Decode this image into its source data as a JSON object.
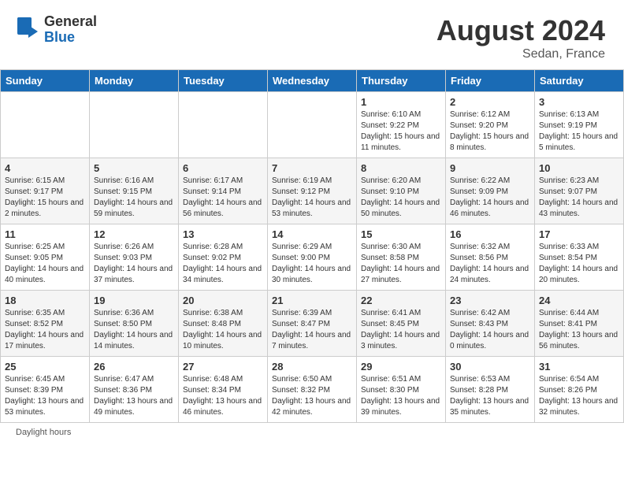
{
  "header": {
    "logo_general": "General",
    "logo_blue": "Blue",
    "month_year": "August 2024",
    "location": "Sedan, France"
  },
  "days_of_week": [
    "Sunday",
    "Monday",
    "Tuesday",
    "Wednesday",
    "Thursday",
    "Friday",
    "Saturday"
  ],
  "footer": {
    "note": "Daylight hours"
  },
  "weeks": [
    {
      "days": [
        {
          "num": "",
          "detail": ""
        },
        {
          "num": "",
          "detail": ""
        },
        {
          "num": "",
          "detail": ""
        },
        {
          "num": "",
          "detail": ""
        },
        {
          "num": "1",
          "detail": "Sunrise: 6:10 AM\nSunset: 9:22 PM\nDaylight: 15 hours\nand 11 minutes."
        },
        {
          "num": "2",
          "detail": "Sunrise: 6:12 AM\nSunset: 9:20 PM\nDaylight: 15 hours\nand 8 minutes."
        },
        {
          "num": "3",
          "detail": "Sunrise: 6:13 AM\nSunset: 9:19 PM\nDaylight: 15 hours\nand 5 minutes."
        }
      ]
    },
    {
      "days": [
        {
          "num": "4",
          "detail": "Sunrise: 6:15 AM\nSunset: 9:17 PM\nDaylight: 15 hours\nand 2 minutes."
        },
        {
          "num": "5",
          "detail": "Sunrise: 6:16 AM\nSunset: 9:15 PM\nDaylight: 14 hours\nand 59 minutes."
        },
        {
          "num": "6",
          "detail": "Sunrise: 6:17 AM\nSunset: 9:14 PM\nDaylight: 14 hours\nand 56 minutes."
        },
        {
          "num": "7",
          "detail": "Sunrise: 6:19 AM\nSunset: 9:12 PM\nDaylight: 14 hours\nand 53 minutes."
        },
        {
          "num": "8",
          "detail": "Sunrise: 6:20 AM\nSunset: 9:10 PM\nDaylight: 14 hours\nand 50 minutes."
        },
        {
          "num": "9",
          "detail": "Sunrise: 6:22 AM\nSunset: 9:09 PM\nDaylight: 14 hours\nand 46 minutes."
        },
        {
          "num": "10",
          "detail": "Sunrise: 6:23 AM\nSunset: 9:07 PM\nDaylight: 14 hours\nand 43 minutes."
        }
      ]
    },
    {
      "days": [
        {
          "num": "11",
          "detail": "Sunrise: 6:25 AM\nSunset: 9:05 PM\nDaylight: 14 hours\nand 40 minutes."
        },
        {
          "num": "12",
          "detail": "Sunrise: 6:26 AM\nSunset: 9:03 PM\nDaylight: 14 hours\nand 37 minutes."
        },
        {
          "num": "13",
          "detail": "Sunrise: 6:28 AM\nSunset: 9:02 PM\nDaylight: 14 hours\nand 34 minutes."
        },
        {
          "num": "14",
          "detail": "Sunrise: 6:29 AM\nSunset: 9:00 PM\nDaylight: 14 hours\nand 30 minutes."
        },
        {
          "num": "15",
          "detail": "Sunrise: 6:30 AM\nSunset: 8:58 PM\nDaylight: 14 hours\nand 27 minutes."
        },
        {
          "num": "16",
          "detail": "Sunrise: 6:32 AM\nSunset: 8:56 PM\nDaylight: 14 hours\nand 24 minutes."
        },
        {
          "num": "17",
          "detail": "Sunrise: 6:33 AM\nSunset: 8:54 PM\nDaylight: 14 hours\nand 20 minutes."
        }
      ]
    },
    {
      "days": [
        {
          "num": "18",
          "detail": "Sunrise: 6:35 AM\nSunset: 8:52 PM\nDaylight: 14 hours\nand 17 minutes."
        },
        {
          "num": "19",
          "detail": "Sunrise: 6:36 AM\nSunset: 8:50 PM\nDaylight: 14 hours\nand 14 minutes."
        },
        {
          "num": "20",
          "detail": "Sunrise: 6:38 AM\nSunset: 8:48 PM\nDaylight: 14 hours\nand 10 minutes."
        },
        {
          "num": "21",
          "detail": "Sunrise: 6:39 AM\nSunset: 8:47 PM\nDaylight: 14 hours\nand 7 minutes."
        },
        {
          "num": "22",
          "detail": "Sunrise: 6:41 AM\nSunset: 8:45 PM\nDaylight: 14 hours\nand 3 minutes."
        },
        {
          "num": "23",
          "detail": "Sunrise: 6:42 AM\nSunset: 8:43 PM\nDaylight: 14 hours\nand 0 minutes."
        },
        {
          "num": "24",
          "detail": "Sunrise: 6:44 AM\nSunset: 8:41 PM\nDaylight: 13 hours\nand 56 minutes."
        }
      ]
    },
    {
      "days": [
        {
          "num": "25",
          "detail": "Sunrise: 6:45 AM\nSunset: 8:39 PM\nDaylight: 13 hours\nand 53 minutes."
        },
        {
          "num": "26",
          "detail": "Sunrise: 6:47 AM\nSunset: 8:36 PM\nDaylight: 13 hours\nand 49 minutes."
        },
        {
          "num": "27",
          "detail": "Sunrise: 6:48 AM\nSunset: 8:34 PM\nDaylight: 13 hours\nand 46 minutes."
        },
        {
          "num": "28",
          "detail": "Sunrise: 6:50 AM\nSunset: 8:32 PM\nDaylight: 13 hours\nand 42 minutes."
        },
        {
          "num": "29",
          "detail": "Sunrise: 6:51 AM\nSunset: 8:30 PM\nDaylight: 13 hours\nand 39 minutes."
        },
        {
          "num": "30",
          "detail": "Sunrise: 6:53 AM\nSunset: 8:28 PM\nDaylight: 13 hours\nand 35 minutes."
        },
        {
          "num": "31",
          "detail": "Sunrise: 6:54 AM\nSunset: 8:26 PM\nDaylight: 13 hours\nand 32 minutes."
        }
      ]
    }
  ]
}
